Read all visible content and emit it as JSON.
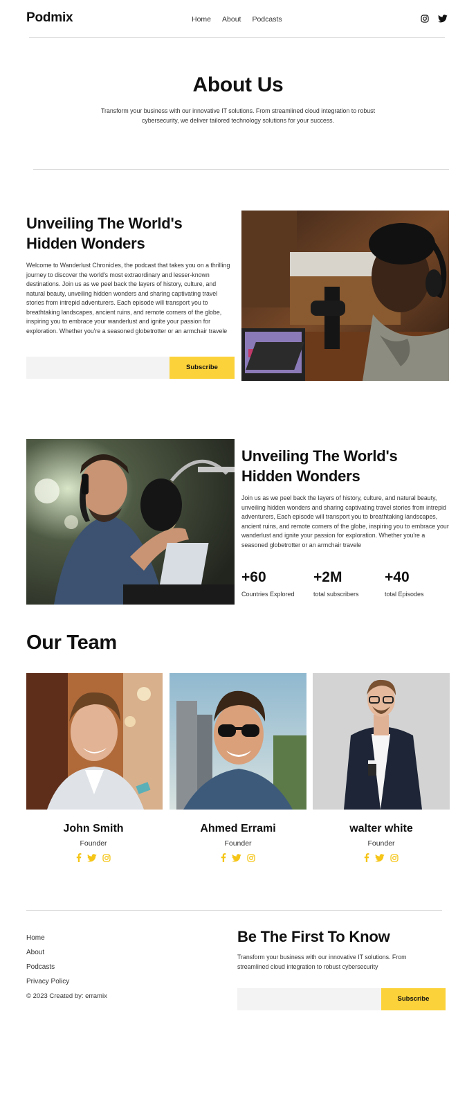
{
  "header": {
    "logo": "Podmix",
    "nav": [
      "Home",
      "About",
      "Podcasts"
    ],
    "icons": [
      "instagram-icon",
      "twitter-icon"
    ]
  },
  "about": {
    "title": "About Us",
    "subtitle": "Transform your business with our innovative IT solutions. From streamlined cloud integration to robust cybersecurity, we deliver tailored technology solutions for your success."
  },
  "section1": {
    "title": "Unveiling The World's Hidden Wonders",
    "body": "Welcome to Wanderlust Chronicles, the podcast that takes you on a thrilling journey to discover the world's most extraordinary and lesser-known destinations. Join us as we peel back the layers of history, culture, and natural beauty, unveiling hidden wonders and sharing captivating travel stories from intrepid adventurers. Each episode will transport you to breathtaking landscapes, ancient ruins, and remote corners of the globe, inspiring you to embrace your wanderlust and ignite your passion for exploration. Whether you're a seasoned globetrotter or an armchair travele",
    "input_value": "",
    "subscribe_label": "Subscribe"
  },
  "section2": {
    "title": "Unveiling The World's Hidden Wonders",
    "body": "Join us as we peel back the layers of history, culture, and natural beauty, unveiling hidden wonders and sharing captivating travel stories from intrepid adventurers, Each episode will transport you to breathtaking landscapes, ancient ruins, and remote corners of the globe, inspiring you to embrace your wanderlust and ignite your passion for exploration. Whether you're a seasoned globetrotter or an armchair travele",
    "stats": [
      {
        "value": "+60",
        "label": "Countries Explored"
      },
      {
        "value": "+2M",
        "label": "total subscribers"
      },
      {
        "value": "+40",
        "label": "total Episodes"
      }
    ]
  },
  "team": {
    "title": "Our Team",
    "members": [
      {
        "name": "John Smith",
        "role": "Founder"
      },
      {
        "name": "Ahmed Errami",
        "role": "Founder"
      },
      {
        "name": "walter white",
        "role": "Founder"
      }
    ],
    "social_icons": [
      "facebook-icon",
      "twitter-icon",
      "instagram-icon"
    ],
    "accent": "#f5c518"
  },
  "footer": {
    "links": [
      "Home",
      "About",
      "Podcasts",
      "Privacy Policy"
    ],
    "copyright": "© 2023 Created by: erramix",
    "newsletter_title": "Be The First To Know",
    "newsletter_sub": "Transform your business with our innovative IT solutions. From streamlined cloud integration to robust cybersecurity",
    "input_value": "",
    "subscribe_label": "Subscribe"
  },
  "colors": {
    "accent": "#fcd23a",
    "input_bg": "#f3f3f3",
    "text": "#111111",
    "divider": "#d6d6d6"
  }
}
